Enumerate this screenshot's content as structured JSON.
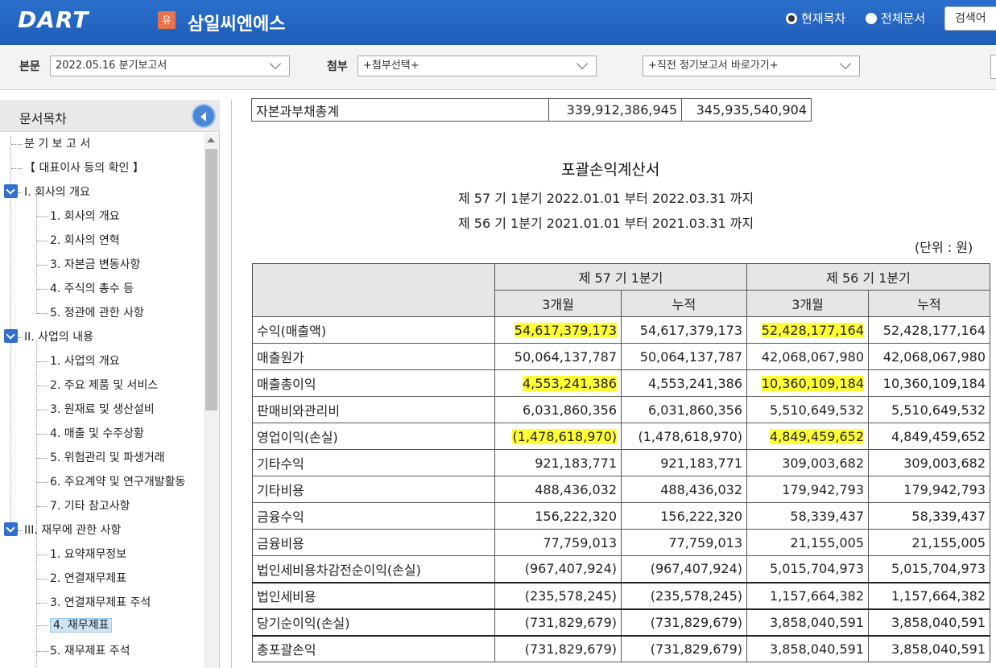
{
  "header": {
    "logo": "DART",
    "corp_badge": "유",
    "corp_name": "삼일씨엔에스",
    "radio_current": "현재목차",
    "radio_all": "전체문서",
    "search_button": "검색어"
  },
  "selectors": {
    "main_label": "본문",
    "main_value": "2022.05.16  분기보고서",
    "attach_label": "첨부",
    "attach_value": "+첨부선택+",
    "recent_value": "+직전 정기보고서 바로가기+"
  },
  "sidebar": {
    "title": "문서목차",
    "items": [
      {
        "label": "분 기 보 고 서"
      },
      {
        "label": "【 대표이사 등의 확인 】"
      },
      {
        "label": "I. 회사의 개요"
      },
      {
        "label": "1. 회사의 개요"
      },
      {
        "label": "2. 회사의 연혁"
      },
      {
        "label": "3. 자본금 변동사항"
      },
      {
        "label": "4. 주식의 총수 등"
      },
      {
        "label": "5. 정관에 관한 사항"
      },
      {
        "label": "II. 사업의 내용"
      },
      {
        "label": "1. 사업의 개요"
      },
      {
        "label": "2. 주요 제품 및 서비스"
      },
      {
        "label": "3. 원재료 및 생산설비"
      },
      {
        "label": "4. 매출 및 수주상황"
      },
      {
        "label": "5. 위험관리 및 파생거래"
      },
      {
        "label": "6. 주요계약 및 연구개발활동"
      },
      {
        "label": "7. 기타 참고사항"
      },
      {
        "label": "III. 재무에 관한 사항"
      },
      {
        "label": "1. 요약재무정보"
      },
      {
        "label": "2. 연결재무제표"
      },
      {
        "label": "3. 연결재무제표 주석"
      },
      {
        "label": "4. 재무제표"
      },
      {
        "label": "5. 재무제표 주석"
      }
    ]
  },
  "prev_row": {
    "label": "자본과부채총계",
    "v1": "339,912,386,945",
    "v2": "345,935,540,904"
  },
  "statement": {
    "title": "포괄손익계산서",
    "period1": "제 57 기 1분기 2022.01.01 부터 2022.03.31 까지",
    "period2": "제 56 기 1분기 2021.01.01 부터 2021.03.31 까지",
    "unit": "(단위 : 원)",
    "col_group1": "제 57 기 1분기",
    "col_group2": "제 56 기 1분기",
    "sub_3m": "3개월",
    "sub_cum": "누적",
    "rows": [
      {
        "label": "수익(매출액)",
        "a": "54,617,379,173",
        "b": "54,617,379,173",
        "c": "52,428,177,164",
        "d": "52,428,177,164"
      },
      {
        "label": "매출원가",
        "a": "50,064,137,787",
        "b": "50,064,137,787",
        "c": "42,068,067,980",
        "d": "42,068,067,980"
      },
      {
        "label": "매출총이익",
        "a": "4,553,241,386",
        "b": "4,553,241,386",
        "c": "10,360,109,184",
        "d": "10,360,109,184"
      },
      {
        "label": "판매비와관리비",
        "a": "6,031,860,356",
        "b": "6,031,860,356",
        "c": "5,510,649,532",
        "d": "5,510,649,532"
      },
      {
        "label": "영업이익(손실)",
        "a": "(1,478,618,970)",
        "b": "(1,478,618,970)",
        "c": "4,849,459,652",
        "d": "4,849,459,652"
      },
      {
        "label": "기타수익",
        "a": "921,183,771",
        "b": "921,183,771",
        "c": "309,003,682",
        "d": "309,003,682"
      },
      {
        "label": "기타비용",
        "a": "488,436,032",
        "b": "488,436,032",
        "c": "179,942,793",
        "d": "179,942,793"
      },
      {
        "label": "금융수익",
        "a": "156,222,320",
        "b": "156,222,320",
        "c": "58,339,437",
        "d": "58,339,437"
      },
      {
        "label": "금융비용",
        "a": "77,759,013",
        "b": "77,759,013",
        "c": "21,155,005",
        "d": "21,155,005"
      },
      {
        "label": "법인세비용차감전순이익(손실)",
        "a": "(967,407,924)",
        "b": "(967,407,924)",
        "c": "5,015,704,973",
        "d": "5,015,704,973"
      },
      {
        "label": "법인세비용",
        "a": "(235,578,245)",
        "b": "(235,578,245)",
        "c": "1,157,664,382",
        "d": "1,157,664,382"
      },
      {
        "label": "당기순이익(손실)",
        "a": "(731,829,679)",
        "b": "(731,829,679)",
        "c": "3,858,040,591",
        "d": "3,858,040,591"
      },
      {
        "label": "총포괄손익",
        "a": "(731,829,679)",
        "b": "(731,829,679)",
        "c": "3,858,040,591",
        "d": "3,858,040,591"
      }
    ]
  },
  "colors": {
    "header_blue": "#1f5db8",
    "highlight": "#ffff33",
    "selected_bg": "#cfe6f8"
  }
}
